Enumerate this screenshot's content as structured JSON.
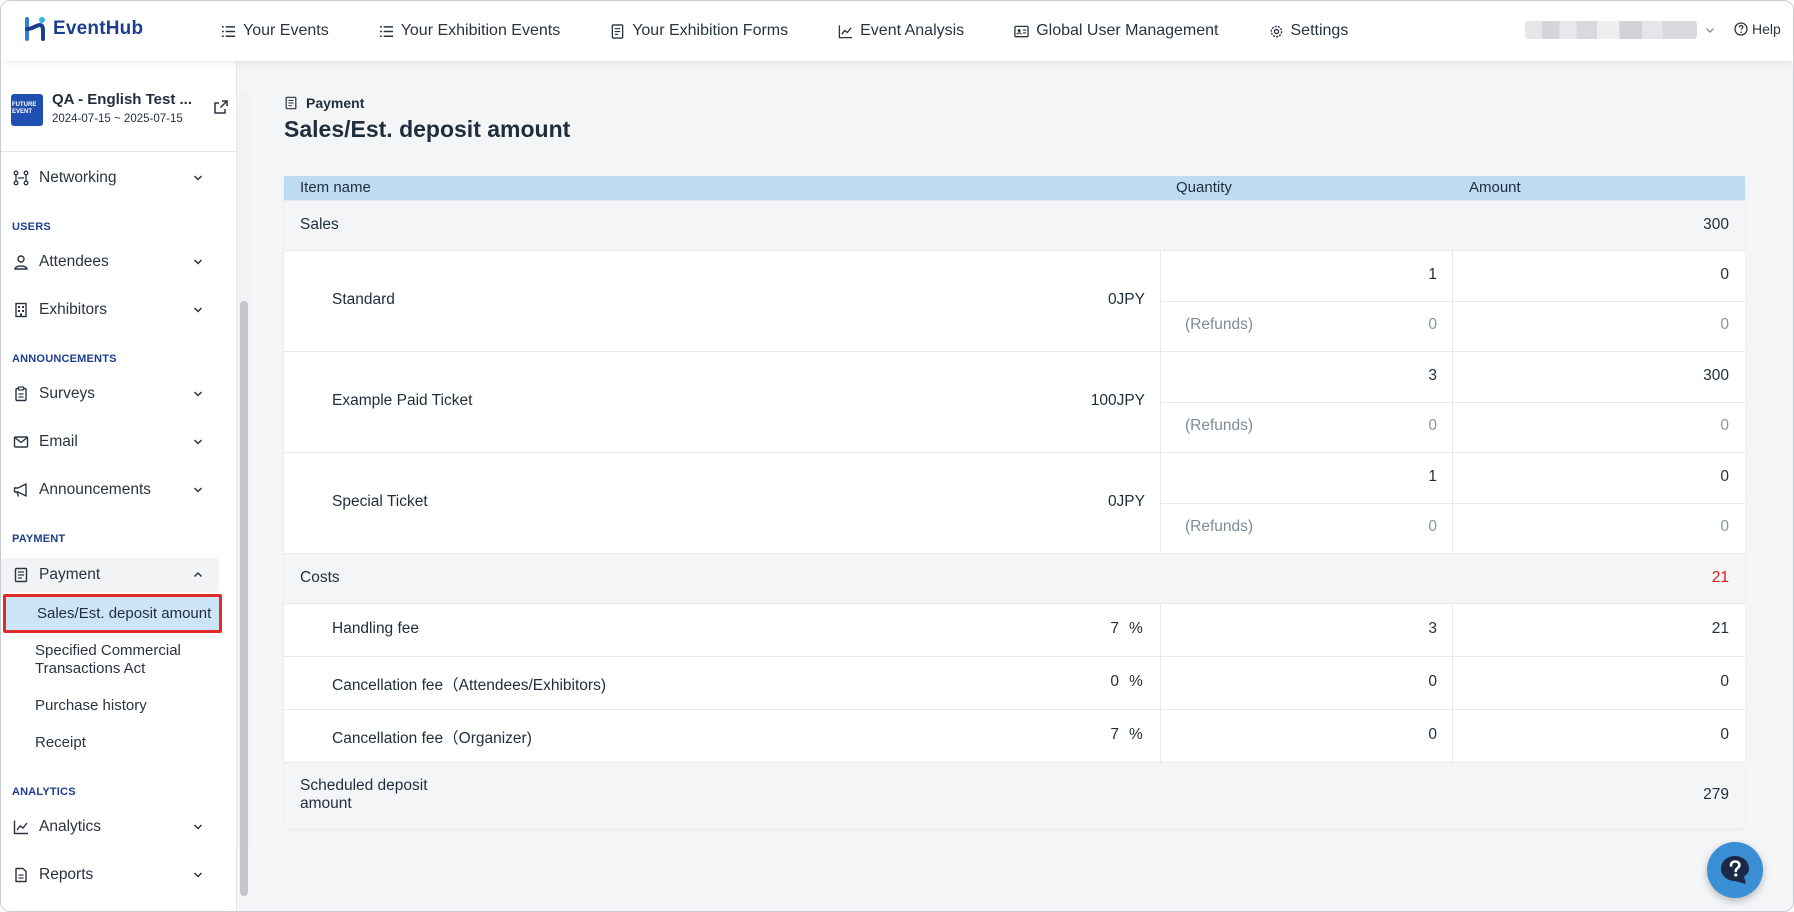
{
  "app": {
    "name": "EventHub"
  },
  "nav": {
    "items": [
      {
        "label": "Your Events",
        "icon": "list-icon"
      },
      {
        "label": "Your Exhibition Events",
        "icon": "list-icon"
      },
      {
        "label": "Your Exhibition Forms",
        "icon": "form-icon"
      },
      {
        "label": "Event Analysis",
        "icon": "chart-icon"
      },
      {
        "label": "Global User Management",
        "icon": "id-card-icon"
      },
      {
        "label": "Settings",
        "icon": "gear-icon"
      }
    ],
    "help_label": "Help"
  },
  "event": {
    "title": "QA - English Test ...",
    "dates": "2024-07-15 ~ 2025-07-15",
    "thumb_text": "FUTURE EVENT"
  },
  "sidebar": {
    "networking": "Networking",
    "section_users": "USERS",
    "attendees": "Attendees",
    "exhibitors": "Exhibitors",
    "section_announcements": "ANNOUNCEMENTS",
    "surveys": "Surveys",
    "email": "Email",
    "announcements": "Announcements",
    "section_payment": "PAYMENT",
    "payment": "Payment",
    "payment_sub": {
      "sales": "Sales/Est. deposit amount",
      "commercial_line1": "Specified Commercial",
      "commercial_line2": "Transactions Act",
      "purchase_history": "Purchase history",
      "receipt": "Receipt"
    },
    "section_analytics": "ANALYTICS",
    "analytics": "Analytics",
    "reports": "Reports"
  },
  "page": {
    "breadcrumb": "Payment",
    "title": "Sales/Est. deposit amount"
  },
  "table": {
    "headers": {
      "item": "Item name",
      "quantity": "Quantity",
      "amount": "Amount"
    },
    "sales": {
      "label": "Sales",
      "amount": "300",
      "items": [
        {
          "name": "Standard",
          "price": "0JPY",
          "qty": "1",
          "amount": "0",
          "refund_label": "(Refunds)",
          "refund_qty": "0",
          "refund_amount": "0"
        },
        {
          "name": "Example Paid Ticket",
          "price": "100JPY",
          "qty": "3",
          "amount": "300",
          "refund_label": "(Refunds)",
          "refund_qty": "0",
          "refund_amount": "0"
        },
        {
          "name": "Special Ticket",
          "price": "0JPY",
          "qty": "1",
          "amount": "0",
          "refund_label": "(Refunds)",
          "refund_qty": "0",
          "refund_amount": "0"
        }
      ]
    },
    "costs": {
      "label": "Costs",
      "amount": "21",
      "items": [
        {
          "name": "Handling fee",
          "rate": "7",
          "unit": "%",
          "qty": "3",
          "amount": "21"
        },
        {
          "name": "Cancellation fee（Attendees/Exhibitors)",
          "rate": "0",
          "unit": "%",
          "qty": "0",
          "amount": "0"
        },
        {
          "name": "Cancellation fee（Organizer)",
          "rate": "7",
          "unit": "%",
          "qty": "0",
          "amount": "0"
        }
      ]
    },
    "deposit": {
      "label_line1": "Scheduled deposit",
      "label_line2": "amount",
      "amount": "279"
    }
  },
  "colors": {
    "brand": "#1d3e8e",
    "header_bg": "#bddcf3",
    "active_bg": "#cde3f6",
    "highlight_border": "#e12b2b",
    "cost_red": "#d71e1e",
    "fab": "#3a8ed4"
  }
}
